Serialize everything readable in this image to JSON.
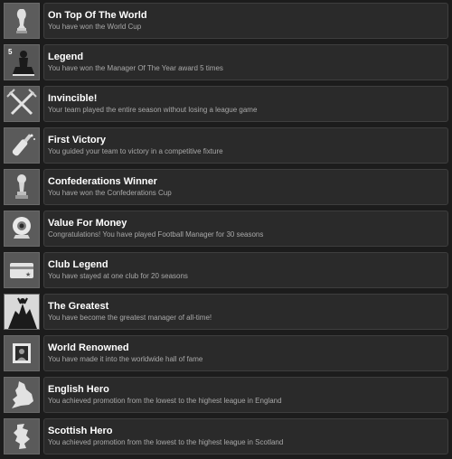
{
  "achievements": [
    {
      "title": "On Top Of The World",
      "description": "You have won the World Cup",
      "icon": "world-cup-trophy-icon"
    },
    {
      "title": "Legend",
      "description": "You have won the Manager Of The Year award 5 times",
      "icon": "award-statue-icon",
      "badge": "5"
    },
    {
      "title": "Invincible!",
      "description": "Your team played the entire season without losing a league game",
      "icon": "crossed-swords-icon"
    },
    {
      "title": "First Victory",
      "description": "You guided your team to victory in a competitive fixture",
      "icon": "champagne-bottle-icon"
    },
    {
      "title": "Confederations Winner",
      "description": "You have won the Confederations Cup",
      "icon": "confederations-trophy-icon"
    },
    {
      "title": "Value For Money",
      "description": "Congratulations! You have played Football Manager for 30 seasons",
      "icon": "webcam-icon"
    },
    {
      "title": "Club Legend",
      "description": "You have stayed at one club for 20 seasons",
      "icon": "membership-card-icon"
    },
    {
      "title": "The Greatest",
      "description": "You have become the greatest manager of all-time!",
      "icon": "celebration-silhouette-icon"
    },
    {
      "title": "World Renowned",
      "description": "You have made it into the worldwide hall of fame",
      "icon": "framed-portrait-icon"
    },
    {
      "title": "English Hero",
      "description": "You achieved promotion from the lowest to the highest league in England",
      "icon": "england-map-icon"
    },
    {
      "title": "Scottish Hero",
      "description": "You achieved promotion from the lowest to the highest league in Scotland",
      "icon": "scotland-map-icon"
    }
  ]
}
